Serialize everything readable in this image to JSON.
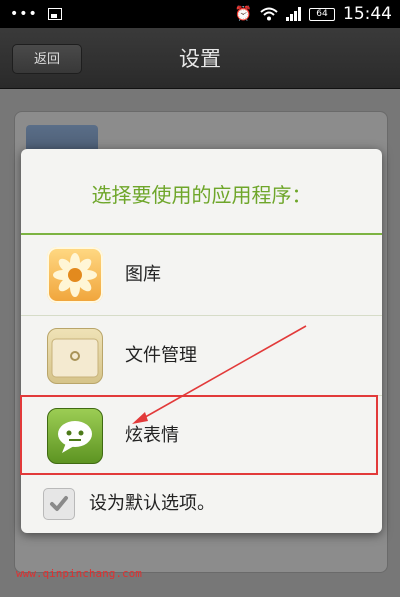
{
  "status_bar": {
    "dots": "•••",
    "time": "15:44",
    "battery": "64",
    "icons": [
      "image-icon",
      "alarm-icon",
      "wifi-icon",
      "signal-icon",
      "battery-icon"
    ]
  },
  "header": {
    "back_label": "返回",
    "title": "设置"
  },
  "dialog": {
    "title": "选择要使用的应用程序：",
    "items": [
      {
        "label": "图库",
        "icon": "gallery-icon"
      },
      {
        "label": "文件管理",
        "icon": "file-manager-icon"
      },
      {
        "label": "炫表情",
        "icon": "chat-icon"
      }
    ],
    "default_label": "设为默认选项。",
    "default_checked": true
  },
  "watermark": "www.qinpinchang.com",
  "colors": {
    "accent": "#6ea62a",
    "highlight": "#e23a3a"
  }
}
